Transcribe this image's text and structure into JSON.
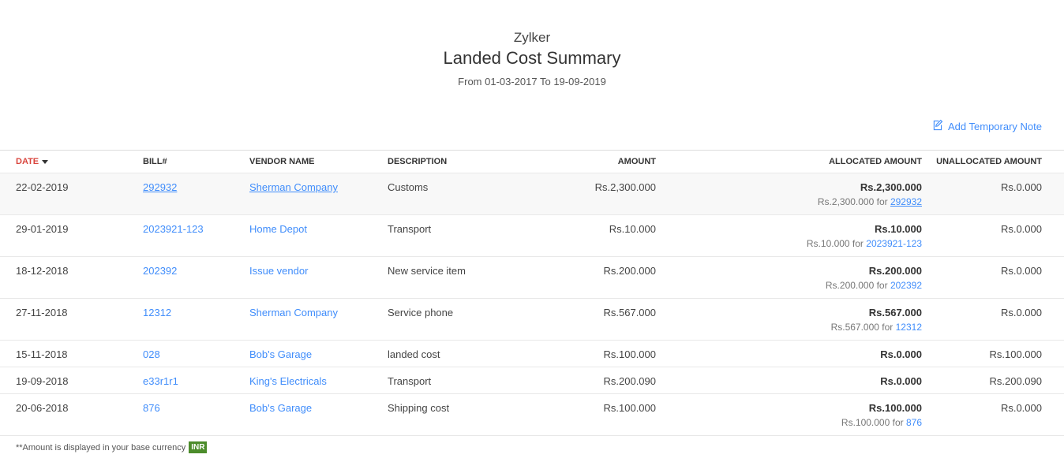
{
  "report": {
    "organization": "Zylker",
    "title": "Landed Cost Summary",
    "date_range": "From 01-03-2017 To 19-09-2019",
    "add_note_label": "Add Temporary Note"
  },
  "columns": {
    "date": "DATE",
    "bill": "BILL#",
    "vendor": "VENDOR NAME",
    "description": "DESCRIPTION",
    "amount": "AMOUNT",
    "allocated": "ALLOCATED AMOUNT",
    "unallocated": "UNALLOCATED AMOUNT"
  },
  "rows": [
    {
      "date": "22-02-2019",
      "bill": "292932",
      "vendor": "Sherman Company",
      "description": "Customs",
      "amount": "Rs.2,300.000",
      "allocated": "Rs.2,300.000",
      "alloc_sub_prefix": "Rs.2,300.000 for ",
      "alloc_sub_bill": "292932",
      "unallocated": "Rs.0.000"
    },
    {
      "date": "29-01-2019",
      "bill": "2023921-123",
      "vendor": "Home Depot",
      "description": "Transport",
      "amount": "Rs.10.000",
      "allocated": "Rs.10.000",
      "alloc_sub_prefix": "Rs.10.000 for ",
      "alloc_sub_bill": "2023921-123",
      "unallocated": "Rs.0.000"
    },
    {
      "date": "18-12-2018",
      "bill": "202392",
      "vendor": "Issue vendor",
      "description": "New service item",
      "amount": "Rs.200.000",
      "allocated": "Rs.200.000",
      "alloc_sub_prefix": "Rs.200.000 for ",
      "alloc_sub_bill": "202392",
      "unallocated": "Rs.0.000"
    },
    {
      "date": "27-11-2018",
      "bill": "12312",
      "vendor": "Sherman Company",
      "description": "Service phone",
      "amount": "Rs.567.000",
      "allocated": "Rs.567.000",
      "alloc_sub_prefix": "Rs.567.000 for ",
      "alloc_sub_bill": "12312",
      "unallocated": "Rs.0.000"
    },
    {
      "date": "15-11-2018",
      "bill": "028",
      "vendor": "Bob's Garage",
      "description": "landed cost",
      "amount": "Rs.100.000",
      "allocated": "Rs.0.000",
      "unallocated": "Rs.100.000"
    },
    {
      "date": "19-09-2018",
      "bill": "e33r1r1",
      "vendor": "King's Electricals",
      "description": "Transport",
      "amount": "Rs.200.090",
      "allocated": "Rs.0.000",
      "unallocated": "Rs.200.090"
    },
    {
      "date": "20-06-2018",
      "bill": "876",
      "vendor": "Bob's Garage",
      "description": "Shipping cost",
      "amount": "Rs.100.000",
      "allocated": "Rs.100.000",
      "alloc_sub_prefix": "Rs.100.000 for ",
      "alloc_sub_bill": "876",
      "unallocated": "Rs.0.000"
    }
  ],
  "footer": {
    "note": "**Amount is displayed in your base currency",
    "currency": "INR"
  },
  "colors": {
    "link": "#408dfb",
    "sort_active": "#d9453d",
    "currency_badge": "#4c8c2b"
  }
}
